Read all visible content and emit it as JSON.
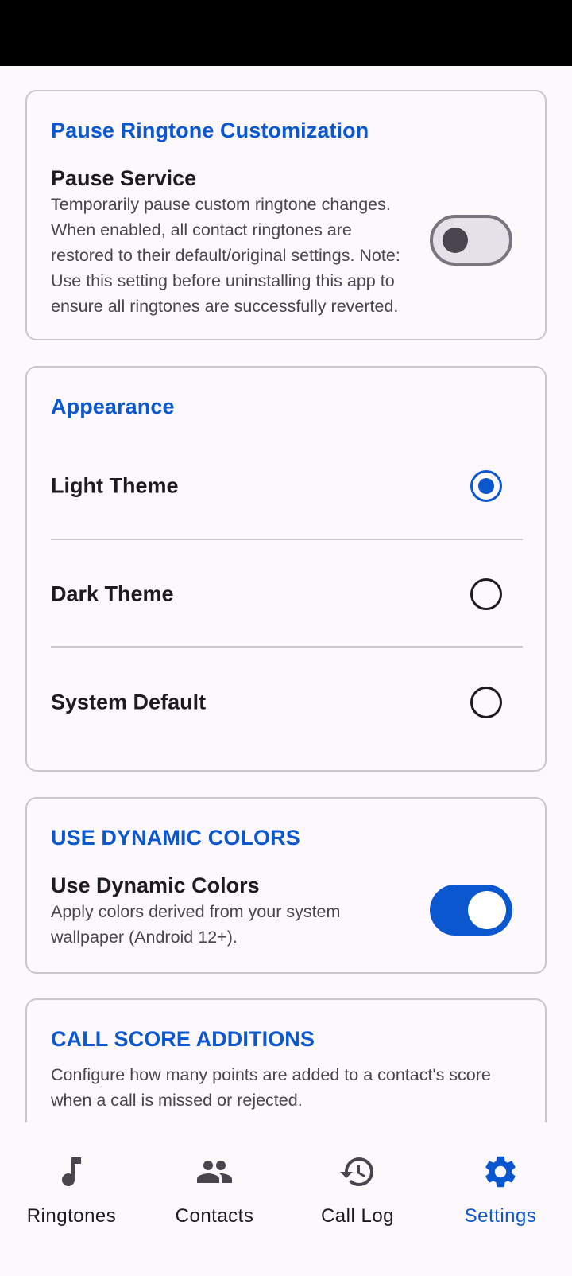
{
  "pause_card": {
    "title": "Pause Ringtone Customization",
    "row_title": "Pause Service",
    "description": "Temporarily pause custom ringtone changes. When enabled, all contact ringtones are restored to their default/original settings. Note: Use this setting before uninstalling this app to ensure all ringtones are successfully reverted.",
    "switch_on": false
  },
  "appearance_card": {
    "title": "Appearance",
    "options": [
      {
        "label": "Light Theme",
        "selected": true
      },
      {
        "label": "Dark Theme",
        "selected": false
      },
      {
        "label": "System Default",
        "selected": false
      }
    ]
  },
  "dynamic_card": {
    "title": "USE DYNAMIC COLORS",
    "row_title": "Use Dynamic Colors",
    "description": "Apply colors derived from your system wallpaper (Android 12+).",
    "switch_on": true
  },
  "call_score_card": {
    "title": "CALL SCORE ADDITIONS",
    "description": "Configure how many points are added to a contact's score when a call is missed or rejected."
  },
  "bottom_nav": {
    "items": [
      {
        "label": "Ringtones",
        "icon": "music-note-icon",
        "active": false
      },
      {
        "label": "Contacts",
        "icon": "people-icon",
        "active": false
      },
      {
        "label": "Call Log",
        "icon": "history-icon",
        "active": false
      },
      {
        "label": "Settings",
        "icon": "gear-icon",
        "active": true
      }
    ]
  },
  "colors": {
    "accent": "#0b57d0",
    "background": "#fcf8fc",
    "outline": "#cbc7cf"
  }
}
